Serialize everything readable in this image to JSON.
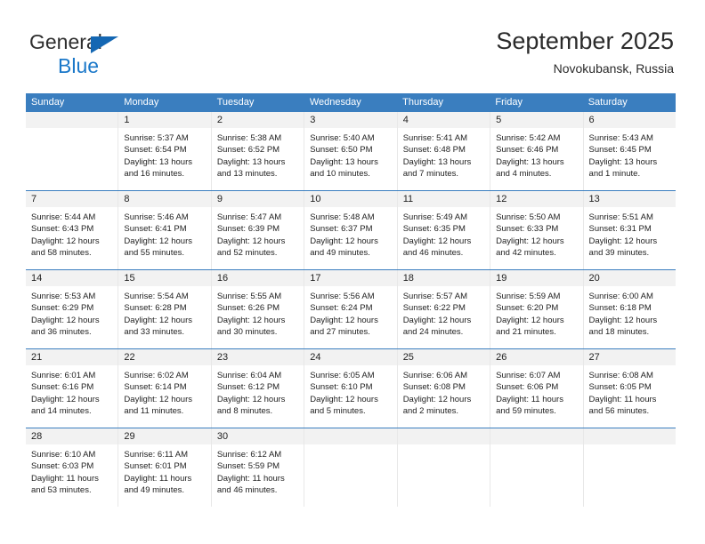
{
  "brand": {
    "line1": "General",
    "line2": "Blue",
    "triangle_color": "#1467b3",
    "text_color": "#2e2e2e",
    "blue_color": "#1b78c9"
  },
  "header": {
    "title": "September 2025",
    "subtitle": "Novokubansk, Russia"
  },
  "theme": {
    "header_bg": "#3a7ebf",
    "header_text": "#ffffff",
    "daynum_bg": "#f2f2f2",
    "cell_bg": "#ffffff",
    "divider": "#e8e8e8"
  },
  "weekday_headers": [
    "Sunday",
    "Monday",
    "Tuesday",
    "Wednesday",
    "Thursday",
    "Friday",
    "Saturday"
  ],
  "weeks": [
    [
      {
        "day": "",
        "sunrise": "",
        "sunset": "",
        "daylight1": "",
        "daylight2": "",
        "empty": true
      },
      {
        "day": "1",
        "sunrise": "Sunrise: 5:37 AM",
        "sunset": "Sunset: 6:54 PM",
        "daylight1": "Daylight: 13 hours",
        "daylight2": "and 16 minutes."
      },
      {
        "day": "2",
        "sunrise": "Sunrise: 5:38 AM",
        "sunset": "Sunset: 6:52 PM",
        "daylight1": "Daylight: 13 hours",
        "daylight2": "and 13 minutes."
      },
      {
        "day": "3",
        "sunrise": "Sunrise: 5:40 AM",
        "sunset": "Sunset: 6:50 PM",
        "daylight1": "Daylight: 13 hours",
        "daylight2": "and 10 minutes."
      },
      {
        "day": "4",
        "sunrise": "Sunrise: 5:41 AM",
        "sunset": "Sunset: 6:48 PM",
        "daylight1": "Daylight: 13 hours",
        "daylight2": "and 7 minutes."
      },
      {
        "day": "5",
        "sunrise": "Sunrise: 5:42 AM",
        "sunset": "Sunset: 6:46 PM",
        "daylight1": "Daylight: 13 hours",
        "daylight2": "and 4 minutes."
      },
      {
        "day": "6",
        "sunrise": "Sunrise: 5:43 AM",
        "sunset": "Sunset: 6:45 PM",
        "daylight1": "Daylight: 13 hours",
        "daylight2": "and 1 minute."
      }
    ],
    [
      {
        "day": "7",
        "sunrise": "Sunrise: 5:44 AM",
        "sunset": "Sunset: 6:43 PM",
        "daylight1": "Daylight: 12 hours",
        "daylight2": "and 58 minutes."
      },
      {
        "day": "8",
        "sunrise": "Sunrise: 5:46 AM",
        "sunset": "Sunset: 6:41 PM",
        "daylight1": "Daylight: 12 hours",
        "daylight2": "and 55 minutes."
      },
      {
        "day": "9",
        "sunrise": "Sunrise: 5:47 AM",
        "sunset": "Sunset: 6:39 PM",
        "daylight1": "Daylight: 12 hours",
        "daylight2": "and 52 minutes."
      },
      {
        "day": "10",
        "sunrise": "Sunrise: 5:48 AM",
        "sunset": "Sunset: 6:37 PM",
        "daylight1": "Daylight: 12 hours",
        "daylight2": "and 49 minutes."
      },
      {
        "day": "11",
        "sunrise": "Sunrise: 5:49 AM",
        "sunset": "Sunset: 6:35 PM",
        "daylight1": "Daylight: 12 hours",
        "daylight2": "and 46 minutes."
      },
      {
        "day": "12",
        "sunrise": "Sunrise: 5:50 AM",
        "sunset": "Sunset: 6:33 PM",
        "daylight1": "Daylight: 12 hours",
        "daylight2": "and 42 minutes."
      },
      {
        "day": "13",
        "sunrise": "Sunrise: 5:51 AM",
        "sunset": "Sunset: 6:31 PM",
        "daylight1": "Daylight: 12 hours",
        "daylight2": "and 39 minutes."
      }
    ],
    [
      {
        "day": "14",
        "sunrise": "Sunrise: 5:53 AM",
        "sunset": "Sunset: 6:29 PM",
        "daylight1": "Daylight: 12 hours",
        "daylight2": "and 36 minutes."
      },
      {
        "day": "15",
        "sunrise": "Sunrise: 5:54 AM",
        "sunset": "Sunset: 6:28 PM",
        "daylight1": "Daylight: 12 hours",
        "daylight2": "and 33 minutes."
      },
      {
        "day": "16",
        "sunrise": "Sunrise: 5:55 AM",
        "sunset": "Sunset: 6:26 PM",
        "daylight1": "Daylight: 12 hours",
        "daylight2": "and 30 minutes."
      },
      {
        "day": "17",
        "sunrise": "Sunrise: 5:56 AM",
        "sunset": "Sunset: 6:24 PM",
        "daylight1": "Daylight: 12 hours",
        "daylight2": "and 27 minutes."
      },
      {
        "day": "18",
        "sunrise": "Sunrise: 5:57 AM",
        "sunset": "Sunset: 6:22 PM",
        "daylight1": "Daylight: 12 hours",
        "daylight2": "and 24 minutes."
      },
      {
        "day": "19",
        "sunrise": "Sunrise: 5:59 AM",
        "sunset": "Sunset: 6:20 PM",
        "daylight1": "Daylight: 12 hours",
        "daylight2": "and 21 minutes."
      },
      {
        "day": "20",
        "sunrise": "Sunrise: 6:00 AM",
        "sunset": "Sunset: 6:18 PM",
        "daylight1": "Daylight: 12 hours",
        "daylight2": "and 18 minutes."
      }
    ],
    [
      {
        "day": "21",
        "sunrise": "Sunrise: 6:01 AM",
        "sunset": "Sunset: 6:16 PM",
        "daylight1": "Daylight: 12 hours",
        "daylight2": "and 14 minutes."
      },
      {
        "day": "22",
        "sunrise": "Sunrise: 6:02 AM",
        "sunset": "Sunset: 6:14 PM",
        "daylight1": "Daylight: 12 hours",
        "daylight2": "and 11 minutes."
      },
      {
        "day": "23",
        "sunrise": "Sunrise: 6:04 AM",
        "sunset": "Sunset: 6:12 PM",
        "daylight1": "Daylight: 12 hours",
        "daylight2": "and 8 minutes."
      },
      {
        "day": "24",
        "sunrise": "Sunrise: 6:05 AM",
        "sunset": "Sunset: 6:10 PM",
        "daylight1": "Daylight: 12 hours",
        "daylight2": "and 5 minutes."
      },
      {
        "day": "25",
        "sunrise": "Sunrise: 6:06 AM",
        "sunset": "Sunset: 6:08 PM",
        "daylight1": "Daylight: 12 hours",
        "daylight2": "and 2 minutes."
      },
      {
        "day": "26",
        "sunrise": "Sunrise: 6:07 AM",
        "sunset": "Sunset: 6:06 PM",
        "daylight1": "Daylight: 11 hours",
        "daylight2": "and 59 minutes."
      },
      {
        "day": "27",
        "sunrise": "Sunrise: 6:08 AM",
        "sunset": "Sunset: 6:05 PM",
        "daylight1": "Daylight: 11 hours",
        "daylight2": "and 56 minutes."
      }
    ],
    [
      {
        "day": "28",
        "sunrise": "Sunrise: 6:10 AM",
        "sunset": "Sunset: 6:03 PM",
        "daylight1": "Daylight: 11 hours",
        "daylight2": "and 53 minutes."
      },
      {
        "day": "29",
        "sunrise": "Sunrise: 6:11 AM",
        "sunset": "Sunset: 6:01 PM",
        "daylight1": "Daylight: 11 hours",
        "daylight2": "and 49 minutes."
      },
      {
        "day": "30",
        "sunrise": "Sunrise: 6:12 AM",
        "sunset": "Sunset: 5:59 PM",
        "daylight1": "Daylight: 11 hours",
        "daylight2": "and 46 minutes."
      },
      {
        "day": "",
        "sunrise": "",
        "sunset": "",
        "daylight1": "",
        "daylight2": "",
        "empty": true
      },
      {
        "day": "",
        "sunrise": "",
        "sunset": "",
        "daylight1": "",
        "daylight2": "",
        "empty": true
      },
      {
        "day": "",
        "sunrise": "",
        "sunset": "",
        "daylight1": "",
        "daylight2": "",
        "empty": true
      },
      {
        "day": "",
        "sunrise": "",
        "sunset": "",
        "daylight1": "",
        "daylight2": "",
        "empty": true
      }
    ]
  ]
}
